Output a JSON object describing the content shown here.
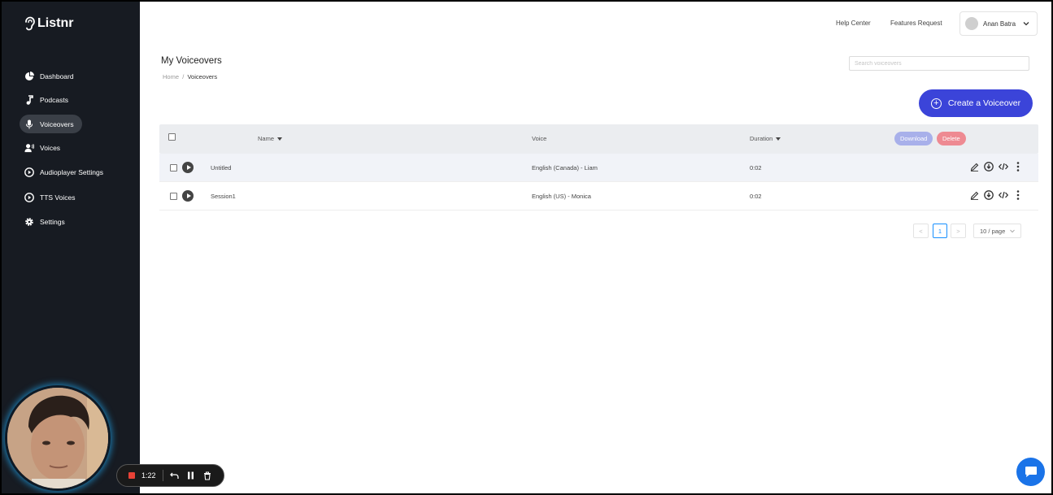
{
  "app": {
    "logo_text": "Listnr"
  },
  "sidebar": {
    "items": [
      {
        "label": "Dashboard",
        "icon": "pie-chart-icon",
        "active": false
      },
      {
        "label": "Podcasts",
        "icon": "music-note-icon",
        "active": false
      },
      {
        "label": "Voiceovers",
        "icon": "microphone-icon",
        "active": true
      },
      {
        "label": "Voices",
        "icon": "user-voice-icon",
        "active": false
      },
      {
        "label": "Audioplayer Settings",
        "icon": "play-circle-icon",
        "active": false
      },
      {
        "label": "TTS Voices",
        "icon": "play-circle-icon",
        "active": false
      },
      {
        "label": "Settings",
        "icon": "gear-icon",
        "active": false
      }
    ]
  },
  "header": {
    "help_center": "Help Center",
    "features_request": "Features Request",
    "user_name": "Anan Batra"
  },
  "page": {
    "title": "My Voiceovers",
    "breadcrumb": {
      "home": "Home",
      "sep": "/",
      "current": "Voiceovers"
    },
    "search_placeholder": "Search voiceovers",
    "create_button": "Create a Voiceover"
  },
  "table": {
    "columns": {
      "name": "Name",
      "voice": "Voice",
      "duration": "Duration"
    },
    "bulk_actions": {
      "download": "Download",
      "delete": "Delete"
    },
    "rows": [
      {
        "name": "Untitled",
        "voice": "English (Canada) - Liam",
        "duration": "0:02"
      },
      {
        "name": "Session1",
        "voice": "English (US) - Monica",
        "duration": "0:02"
      }
    ]
  },
  "pagination": {
    "prev": "<",
    "current_page": "1",
    "next": ">",
    "per_page": "10 / page"
  },
  "recorder": {
    "elapsed": "1:22"
  },
  "colors": {
    "sidebar_bg": "#171b22",
    "accent": "#3b44d9",
    "download_pill": "#a8b0ea",
    "delete_pill": "#ee8a92",
    "chat_button": "#1a73e8"
  }
}
